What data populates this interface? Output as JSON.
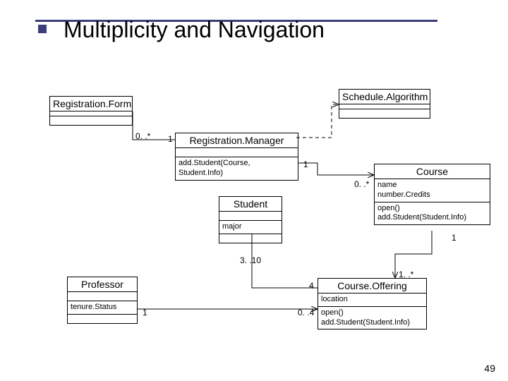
{
  "title": "Multiplicity and Navigation",
  "page_number": "49",
  "classes": {
    "registrationForm": {
      "name": "Registration.Form"
    },
    "scheduleAlgorithm": {
      "name": "Schedule.Algorithm"
    },
    "registrationManager": {
      "name": "Registration.Manager",
      "ops": "add.Student(Course, Student.Info)"
    },
    "student": {
      "name": "Student",
      "attrs": "major"
    },
    "course": {
      "name": "Course",
      "attrs": "name\nnumber.Credits",
      "ops": "open()\nadd.Student(Student.Info)"
    },
    "professor": {
      "name": "Professor",
      "attrs": "tenure.Status"
    },
    "courseOffering": {
      "name": "Course.Offering",
      "attrs": "location",
      "ops": "open()\nadd.Student(Student.Info)"
    }
  },
  "mult": {
    "rf_rm_left": "0. .*",
    "rf_rm_right": "1",
    "rm_course_left": "1",
    "rm_course_right": "0. .*",
    "course_co_top": "1",
    "course_co_bot": "1. .*",
    "student_co_left": "3. .10",
    "student_co_right": "4",
    "prof_co_left": "1",
    "prof_co_right": "0. .4"
  }
}
